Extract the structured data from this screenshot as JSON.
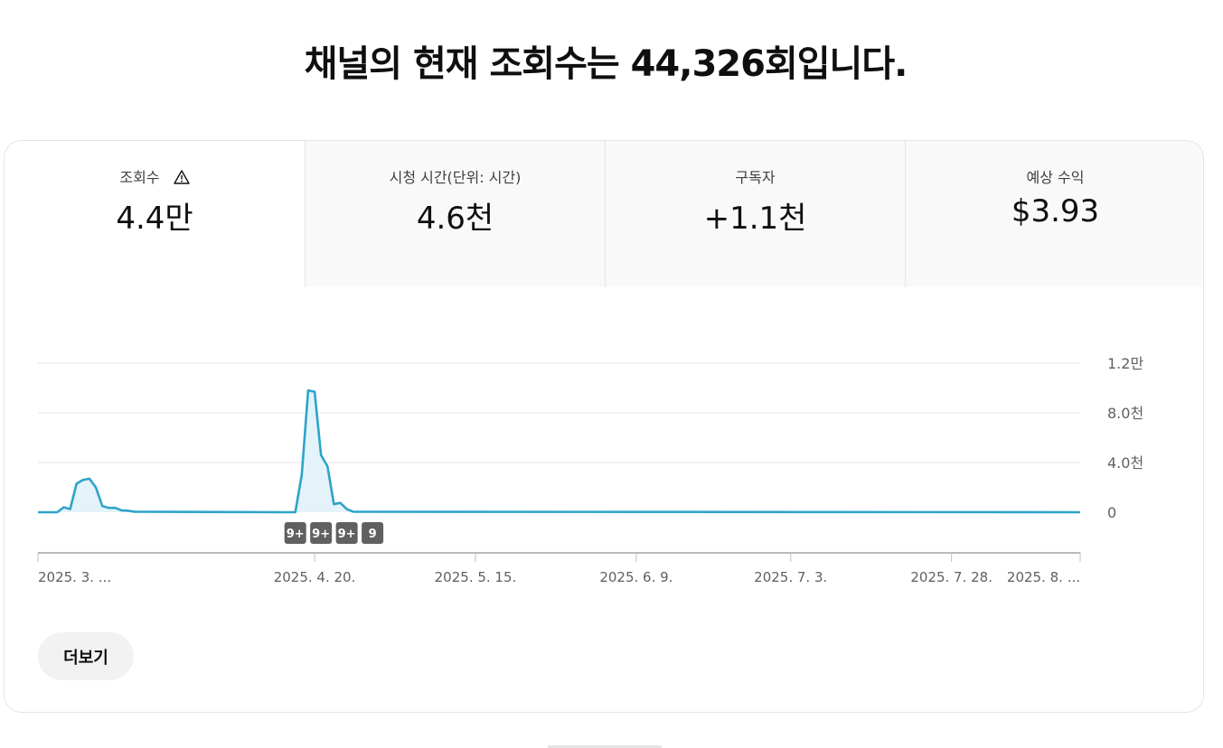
{
  "headline": "채널의 현재 조회수는 44,326회입니다.",
  "tabs": [
    {
      "label": "조회수",
      "value": "4.4만",
      "icon": "warning-icon",
      "selected": true
    },
    {
      "label": "시청 시간(단위: 시간)",
      "value": "4.6천",
      "selected": false
    },
    {
      "label": "구독자",
      "value": "+1.1천",
      "selected": false
    },
    {
      "label": "예상 수익",
      "value": "$3.93",
      "selected": false
    }
  ],
  "more_button": "더보기",
  "colors": {
    "line": "#2ea3c9",
    "area": "#e3f3f9",
    "grid": "#e5e5e5",
    "badge": "#606060"
  },
  "chart_data": {
    "type": "area",
    "y_axis_position": "right",
    "ylim": [
      0,
      12000
    ],
    "y_ticks": [
      {
        "value": 12000,
        "label": "1.2만"
      },
      {
        "value": 8000,
        "label": "8.0천"
      },
      {
        "value": 4000,
        "label": "4.0천"
      },
      {
        "value": 0,
        "label": "0"
      }
    ],
    "x_range": [
      "2025-03-08",
      "2025-08-17"
    ],
    "x_tick_labels": [
      {
        "date": "2025-03-08",
        "label": "2025. 3. ..."
      },
      {
        "date": "2025-04-20",
        "label": "2025. 4. 20."
      },
      {
        "date": "2025-05-15",
        "label": "2025. 5. 15."
      },
      {
        "date": "2025-06-09",
        "label": "2025. 6. 9."
      },
      {
        "date": "2025-07-03",
        "label": "2025. 7. 3."
      },
      {
        "date": "2025-07-28",
        "label": "2025. 7. 28."
      },
      {
        "date": "2025-08-17",
        "label": "2025. 8. ..."
      }
    ],
    "series": [
      {
        "points": [
          [
            "2025-03-08",
            0
          ],
          [
            "2025-03-11",
            0
          ],
          [
            "2025-03-12",
            400
          ],
          [
            "2025-03-13",
            250
          ],
          [
            "2025-03-14",
            2300
          ],
          [
            "2025-03-15",
            2600
          ],
          [
            "2025-03-16",
            2700
          ],
          [
            "2025-03-17",
            2000
          ],
          [
            "2025-03-18",
            500
          ],
          [
            "2025-03-19",
            350
          ],
          [
            "2025-03-20",
            350
          ],
          [
            "2025-03-21",
            150
          ],
          [
            "2025-03-22",
            120
          ],
          [
            "2025-03-23",
            40
          ],
          [
            "2025-04-16",
            0
          ],
          [
            "2025-04-17",
            0
          ],
          [
            "2025-04-18",
            3000
          ],
          [
            "2025-04-19",
            9800
          ],
          [
            "2025-04-20",
            9700
          ],
          [
            "2025-04-21",
            4600
          ],
          [
            "2025-04-22",
            3700
          ],
          [
            "2025-04-23",
            650
          ],
          [
            "2025-04-24",
            750
          ],
          [
            "2025-04-25",
            250
          ],
          [
            "2025-04-26",
            40
          ],
          [
            "2025-08-17",
            0
          ]
        ]
      }
    ],
    "markers": [
      {
        "date": "2025-04-17",
        "label": "9+"
      },
      {
        "date": "2025-04-21",
        "label": "9+"
      },
      {
        "date": "2025-04-25",
        "label": "9+"
      },
      {
        "date": "2025-04-29",
        "label": "9"
      }
    ]
  }
}
